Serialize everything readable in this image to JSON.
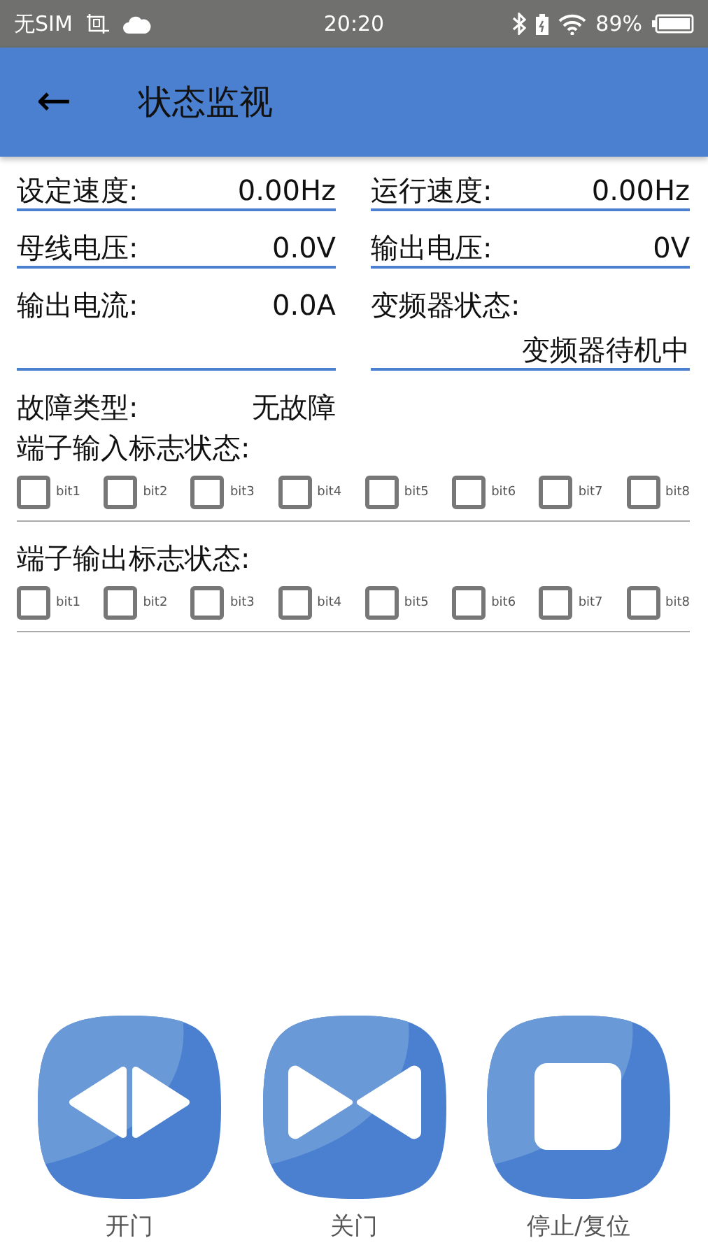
{
  "status_bar": {
    "carrier": "无SIM",
    "time": "20:20",
    "battery": "89%"
  },
  "header": {
    "back": "←",
    "title": "状态监视"
  },
  "fields": [
    {
      "label": "设定速度:",
      "value": "0.00Hz",
      "kind": "inline",
      "underlined": true
    },
    {
      "label": "运行速度:",
      "value": "0.00Hz",
      "kind": "inline",
      "underlined": true
    },
    {
      "label": "母线电压:",
      "value": "0.0V",
      "kind": "inline",
      "underlined": true
    },
    {
      "label": "输出电压:",
      "value": "0V",
      "kind": "inline",
      "underlined": true
    },
    {
      "label": "输出电流:",
      "value": "0.0A",
      "kind": "inline",
      "underlined": true
    },
    {
      "label": "变频器状态:",
      "value": "变频器待机中",
      "kind": "stacked",
      "underlined": true
    },
    {
      "label": "故障类型:",
      "value": "无故障",
      "kind": "inline",
      "underlined": false
    }
  ],
  "bit_groups": [
    {
      "title": "端子输入标志状态:",
      "bits": [
        {
          "label": "bit1",
          "checked": false
        },
        {
          "label": "bit2",
          "checked": false
        },
        {
          "label": "bit3",
          "checked": false
        },
        {
          "label": "bit4",
          "checked": false
        },
        {
          "label": "bit5",
          "checked": false
        },
        {
          "label": "bit6",
          "checked": false
        },
        {
          "label": "bit7",
          "checked": false
        },
        {
          "label": "bit8",
          "checked": false
        }
      ]
    },
    {
      "title": "端子输出标志状态:",
      "bits": [
        {
          "label": "bit1",
          "checked": false
        },
        {
          "label": "bit2",
          "checked": false
        },
        {
          "label": "bit3",
          "checked": false
        },
        {
          "label": "bit4",
          "checked": false
        },
        {
          "label": "bit5",
          "checked": false
        },
        {
          "label": "bit6",
          "checked": false
        },
        {
          "label": "bit7",
          "checked": false
        },
        {
          "label": "bit8",
          "checked": false
        }
      ]
    }
  ],
  "actions": [
    {
      "label": "开门",
      "kind": "open"
    },
    {
      "label": "关门",
      "kind": "close"
    },
    {
      "label": "停止/复位",
      "kind": "stop"
    }
  ]
}
